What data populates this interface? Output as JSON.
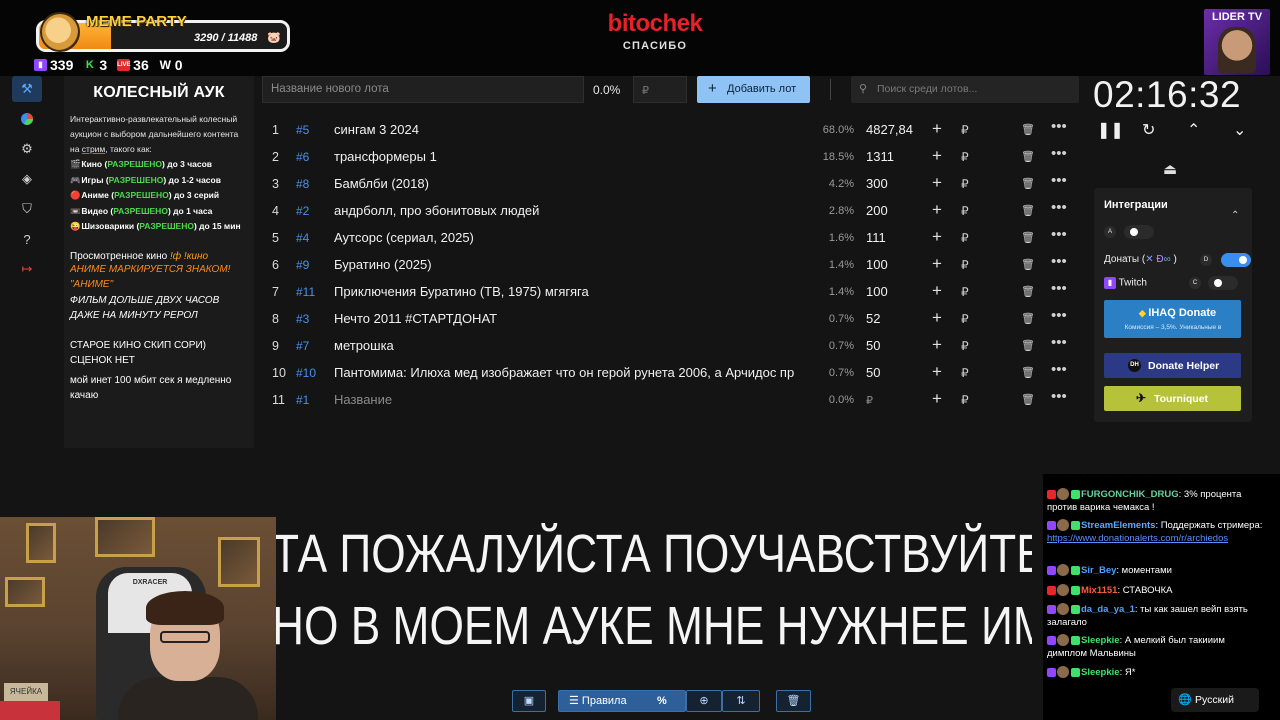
{
  "overlay": {
    "meme_title": "MEME PARTY",
    "meme_score": "3290 / 11488",
    "meme_progress": 0.29,
    "counters": [
      {
        "icon": "twitch-icon",
        "value": "339",
        "color": "#9146ff"
      },
      {
        "icon": "kick-icon",
        "value": "3",
        "color": "#3be24e"
      },
      {
        "icon": "vk-live-icon",
        "value": "36",
        "color": "#e12a2a"
      },
      {
        "icon": "w-icon",
        "value": "0",
        "color": "#ffffff"
      }
    ],
    "brand_name": "bitochek",
    "brand_sub": "СПАСИБО",
    "lider_title": "LIDER TV"
  },
  "sidebar_icons": [
    "gavel-icon",
    "pie-chart-icon",
    "settings-icon",
    "layers-icon",
    "shield-icon",
    "help-icon",
    "logout-icon"
  ],
  "info": {
    "title": "КОЛЕСНЫЙ АУК",
    "desc_1": "Интерактивно-развлекательный колесный аукцион с выбором дальнейшего контента на ",
    "desc_u": "стрим",
    "desc_2": ", такого как:",
    "rules": [
      {
        "icon": "🎬",
        "name": "Кино (",
        "ok": "РАЗРЕШЕНО",
        "tail": ") до 3 часов"
      },
      {
        "icon": "🎮",
        "name": "Игры (",
        "ok": "РАЗРЕШЕНО",
        "tail": ") до 1-2 часов"
      },
      {
        "icon": "🔴",
        "name": "Аниме (",
        "ok": "РАЗРЕШЕНО",
        "tail": ") до 3 серий"
      },
      {
        "icon": "📼",
        "name": "Видео (",
        "ok": "РАЗРЕШЕНО",
        "tail": ") до 1 часа"
      },
      {
        "icon": "😜",
        "name": "Шизоварики (",
        "ok": "РАЗРЕШЕНО",
        "tail": ") до 15 мин"
      }
    ],
    "watched": "Просмотренное кино ",
    "watched_orange": "!ф !кино",
    "warn_1": "АНИМЕ МАРКИРУЕТСЯ ЗНАКОМ! \"АНИМЕ\"",
    "warn_2": "ФИЛЬМ ДОЛЬШЕ ДВУХ ЧАСОВ ДАЖЕ НА МИНУТУ РЕРОЛ",
    "old": "СТАРОЕ КИНО СКИП СОРИ) СЦЕНОК НЕТ",
    "net": "мой инет 100 мбит сек я медленно качаю"
  },
  "toolbar": {
    "lot_placeholder": "Название нового лота",
    "pct": "0.0%",
    "rub_placeholder": "₽",
    "add_label": "Добавить лот",
    "search_placeholder": "Поиск среди лотов..."
  },
  "lots": [
    {
      "num": "1",
      "id": "#5",
      "name": "сингам 3 2024",
      "pct": "68.0%",
      "amount": "4827,84"
    },
    {
      "num": "2",
      "id": "#6",
      "name": "трансформеры 1",
      "pct": "18.5%",
      "amount": "1311"
    },
    {
      "num": "3",
      "id": "#8",
      "name": "Бамблби (2018)",
      "pct": "4.2%",
      "amount": "300"
    },
    {
      "num": "4",
      "id": "#2",
      "name": "андрболл, про эбонитовых людей",
      "pct": "2.8%",
      "amount": "200"
    },
    {
      "num": "5",
      "id": "#4",
      "name": "Аутсорс (сериал, 2025)",
      "pct": "1.6%",
      "amount": "111"
    },
    {
      "num": "6",
      "id": "#9",
      "name": "Буратино (2025)",
      "pct": "1.4%",
      "amount": "100"
    },
    {
      "num": "7",
      "id": "#11",
      "name": "Приключения Буратино (ТВ, 1975) мгягяга",
      "pct": "1.4%",
      "amount": "100"
    },
    {
      "num": "8",
      "id": "#3",
      "name": "Нечто 2011 #СТАРТДОНАТ",
      "pct": "0.7%",
      "amount": "52"
    },
    {
      "num": "9",
      "id": "#7",
      "name": "метрошка",
      "pct": "0.7%",
      "amount": "50"
    },
    {
      "num": "10",
      "id": "#10",
      "name": " Пантомима: Илюха мед изображает что он герой рунета 2006, а Арчидос пр",
      "pct": "0.7%",
      "amount": "50"
    },
    {
      "num": "11",
      "id": "#1",
      "name": "Название",
      "pct": "0.0%",
      "amount": "₽",
      "placeholder": true
    }
  ],
  "lot_row_icons": {
    "plus": "+",
    "rub": "₽",
    "trash": "🗑",
    "more": "•••"
  },
  "timer": {
    "value": "02:16:32"
  },
  "integrations": {
    "title": "Интеграции",
    "toggle_a_tag": "A",
    "donats_label": "Донаты (",
    "donats_close": ")",
    "donats_tag": "D",
    "twitch_label": "Twitch",
    "twitch_tag": "C",
    "ihaq_label": "IHAQ Donate",
    "ihaq_sub": "Комиссия – 3,5%. Уникальные в",
    "dh_label": "Donate Helper",
    "tq_label": "Tourniquet"
  },
  "ticker": {
    "line1": "ТА ПОЖАЛУЙСТА ПОУЧАВСТВУЙТЕ РЕБЯТ",
    "line2": "НО В МОЕМ АУКЕ МНЕ НУЖНЕЕ      ИМЕН"
  },
  "webcam": {
    "box_text": "ЯЧЕЙКА",
    "chair_logo": "DXRACER"
  },
  "chat": [
    {
      "user": "FURGONCHIK_DRUG",
      "color": "#6ad0a0",
      "text": " 3% процента против варика чемакса !"
    },
    {
      "user": "StreamElements",
      "color": "#5aa8ff",
      "text": " Поддержать стримера: ",
      "link": "https://www.donationalerts.com/r/archiedos"
    },
    {
      "user": "Sir_Bey",
      "color": "#4fa0ff",
      "text": " моментами"
    },
    {
      "user": "Mix1151",
      "color": "#ff5a3a",
      "text": " СТАВОЧКА"
    },
    {
      "user": "da_da_ya_1",
      "color": "#4fa0ff",
      "text": " ты как зашел вейп взять залагало"
    },
    {
      "user": "Sleepkie",
      "color": "#3ee26a",
      "text": " А мелкий был такииим димплом Мальвины"
    },
    {
      "user": "Sleepkie",
      "color": "#3ee26a",
      "text": " Я*"
    }
  ],
  "language": "Русский",
  "bottom": {
    "rules_label": "Правила",
    "pct_icon": "%"
  }
}
